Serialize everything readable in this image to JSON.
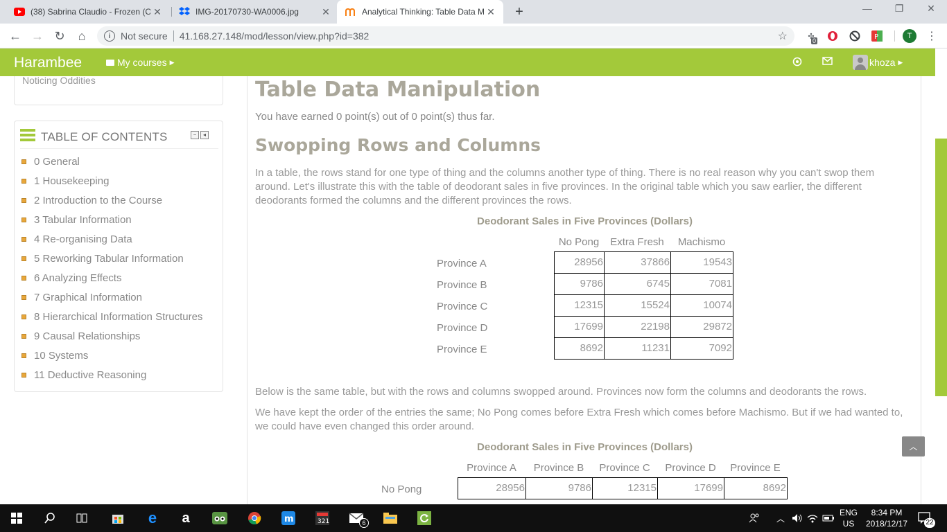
{
  "browser": {
    "tabs": [
      {
        "title": "(38) Sabrina Claudio - Frozen (Of",
        "icon": "youtube-icon"
      },
      {
        "title": "IMG-20170730-WA0006.jpg",
        "icon": "dropbox-icon"
      },
      {
        "title": "Analytical Thinking: Table Data M",
        "icon": "moodle-icon",
        "active": true
      }
    ],
    "new_tab": "+",
    "address": {
      "security_label": "Not secure",
      "url": "41.168.27.148/mod/lesson/view.php?id=382"
    },
    "extension_badge": "0",
    "profile_initial": "T"
  },
  "navbar": {
    "brand": "Harambee",
    "my_courses": "My courses",
    "username": "khoza",
    "accent_color": "#a3c93a"
  },
  "sidebar": {
    "previous_block_text": "Noticing Oddities",
    "toc_title": "TABLE OF CONTENTS",
    "toc_items": [
      "0 General",
      "1 Housekeeping",
      "2 Introduction to the Course",
      "3 Tabular Information",
      "4 Re-organising Data",
      "5 Reworking Tabular Information",
      "6 Analyzing Effects",
      "7 Graphical Information",
      "8 Hierarchical Information Structures",
      "9 Causal Relationships",
      "10 Systems",
      "11 Deductive Reasoning"
    ]
  },
  "lesson": {
    "title": "Table Data Manipulation",
    "earned": "You have earned 0 point(s) out of 0 point(s) thus far.",
    "section_title": "Swopping Rows and Columns",
    "para1": "In a table, the rows stand for one type of thing and the columns another type of thing. There is no real reason why you can't swop them around. Let's illustrate this with the table of deodorant sales in five provinces. In the original table which you saw earlier, the different deodorants formed the columns and the different provinces the rows.",
    "table1": {
      "caption": "Deodorant Sales in Five Provinces (Dollars)",
      "columns": [
        "No Pong",
        "Extra Fresh",
        "Machismo"
      ],
      "rows": [
        {
          "label": "Province A",
          "values": [
            "28956",
            "37866",
            "19543"
          ]
        },
        {
          "label": "Province B",
          "values": [
            "9786",
            "6745",
            "7081"
          ]
        },
        {
          "label": "Province C",
          "values": [
            "12315",
            "15524",
            "10074"
          ]
        },
        {
          "label": "Province D",
          "values": [
            "17699",
            "22198",
            "29872"
          ]
        },
        {
          "label": "Province E",
          "values": [
            "8692",
            "11231",
            "7092"
          ]
        }
      ]
    },
    "para2": "Below is the same table, but with the rows and columns swopped around. Provinces now form the columns and deodorants the rows.",
    "para3": "We have kept the order of the entries the same; No Pong comes before Extra Fresh which comes before Machismo. But if we had wanted to, we could have even changed this order around.",
    "table2": {
      "caption": "Deodorant Sales in Five Provinces (Dollars)",
      "columns": [
        "Province A",
        "Province B",
        "Province C",
        "Province D",
        "Province E"
      ],
      "rows": [
        {
          "label": "No Pong",
          "values": [
            "28956",
            "9786",
            "12315",
            "17699",
            "8692"
          ]
        }
      ]
    }
  },
  "taskbar": {
    "language": "ENG",
    "region": "US",
    "time": "8:34 PM",
    "date": "2018/12/17",
    "notifications": "22",
    "mail_badge": "6"
  }
}
